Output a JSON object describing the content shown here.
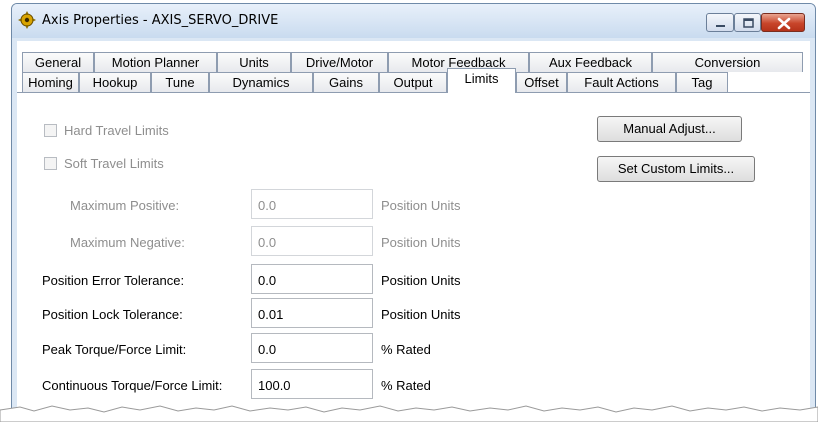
{
  "window": {
    "title": "Axis Properties - AXIS_SERVO_DRIVE",
    "icon": "axis-properties-icon",
    "controls": {
      "minimize": "minimize-icon",
      "maximize": "maximize-icon",
      "close": "close-icon"
    }
  },
  "tabs": {
    "row1": [
      "General",
      "Motion Planner",
      "Units",
      "Drive/Motor",
      "Motor Feedback",
      "Aux Feedback",
      "Conversion"
    ],
    "row2": [
      "Homing",
      "Hookup",
      "Tune",
      "Dynamics",
      "Gains",
      "Output",
      "Limits",
      "Offset",
      "Fault Actions",
      "Tag"
    ],
    "active": "Limits"
  },
  "limits": {
    "hard_travel_limits": {
      "label": "Hard Travel Limits",
      "checked": false,
      "enabled": false
    },
    "soft_travel_limits": {
      "label": "Soft Travel Limits",
      "checked": false,
      "enabled": false
    },
    "maximum_positive": {
      "label": "Maximum Positive:",
      "value": "0.0",
      "unit": "Position Units",
      "enabled": false
    },
    "maximum_negative": {
      "label": "Maximum Negative:",
      "value": "0.0",
      "unit": "Position Units",
      "enabled": false
    },
    "position_error_tolerance": {
      "label": "Position Error Tolerance:",
      "value": "0.0",
      "unit": "Position Units"
    },
    "position_lock_tolerance": {
      "label": "Position Lock Tolerance:",
      "value": "0.01",
      "unit": "Position Units"
    },
    "peak_torque_force_limit": {
      "label": "Peak Torque/Force Limit:",
      "value": "0.0",
      "unit": "% Rated"
    },
    "continuous_torque_force_limit": {
      "label": "Continuous Torque/Force Limit:",
      "value": "100.0",
      "unit": "% Rated"
    }
  },
  "buttons": {
    "manual_adjust": "Manual Adjust...",
    "set_custom_limits": "Set Custom Limits..."
  }
}
